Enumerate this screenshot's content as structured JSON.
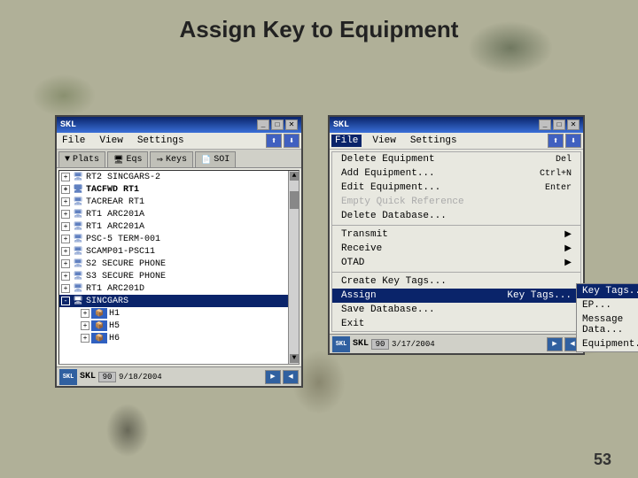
{
  "page": {
    "title": "Assign Key to Equipment",
    "page_number": "53"
  },
  "left_window": {
    "title": "SKL",
    "menu": [
      "File",
      "View",
      "Settings"
    ],
    "tabs": [
      {
        "label": "Plats",
        "icon": "▼",
        "active": false
      },
      {
        "label": "Eqs",
        "icon": "🖥",
        "active": false
      },
      {
        "label": "Keys",
        "icon": "🔑",
        "active": false
      },
      {
        "label": "SOI",
        "icon": "📄",
        "active": false
      }
    ],
    "tree_items": [
      {
        "label": "RT2 SINCGARS-2",
        "indent": 0,
        "expand": "+",
        "icon": "🖥",
        "selected": false
      },
      {
        "label": "TACFWD RT1",
        "indent": 0,
        "expand": "+",
        "icon": "🖥",
        "selected": false,
        "bold": true
      },
      {
        "label": "TACREAR RT1",
        "indent": 0,
        "expand": "+",
        "icon": "🖥",
        "selected": false
      },
      {
        "label": "RT1 ARC201A",
        "indent": 0,
        "expand": "+",
        "icon": "🖥",
        "selected": false
      },
      {
        "label": "RT1 ARC201A",
        "indent": 0,
        "expand": "+",
        "icon": "🖥",
        "selected": false
      },
      {
        "label": "PSC-5 TERM-001",
        "indent": 0,
        "expand": "+",
        "icon": "🖥",
        "selected": false
      },
      {
        "label": "SCAMP01-PSC11",
        "indent": 0,
        "expand": "+",
        "icon": "🖥",
        "selected": false
      },
      {
        "label": "S2 SECURE PHONE",
        "indent": 0,
        "expand": "+",
        "icon": "🖥",
        "selected": false
      },
      {
        "label": "S3 SECURE PHONE",
        "indent": 0,
        "expand": "+",
        "icon": "🖥",
        "selected": false
      },
      {
        "label": "RT1 ARC201D",
        "indent": 0,
        "expand": "+",
        "icon": "🖥",
        "selected": false
      },
      {
        "label": "SINCGARS",
        "indent": 0,
        "expand": "-",
        "icon": "🖥",
        "selected": true
      },
      {
        "label": "H1",
        "indent": 1,
        "expand": "+",
        "icon": "📦",
        "selected": false
      },
      {
        "label": "H5",
        "indent": 1,
        "expand": "+",
        "icon": "📦",
        "selected": false
      },
      {
        "label": "H6",
        "indent": 1,
        "expand": "+",
        "icon": "📦",
        "selected": false
      }
    ],
    "status_bar": {
      "icon_label": "SKL",
      "num": "90",
      "date": "9/18/2004"
    }
  },
  "right_window": {
    "title": "SKL",
    "menu": [
      "File",
      "View",
      "Settings"
    ],
    "active_menu": "File",
    "menu_items": [
      {
        "label": "Delete Equipment",
        "shortcut": "Del",
        "disabled": false
      },
      {
        "label": "Add Equipment...",
        "shortcut": "Ctrl+N",
        "disabled": false
      },
      {
        "label": "Edit Equipment...",
        "shortcut": "Enter",
        "disabled": false
      },
      {
        "label": "Empty Quick Reference",
        "shortcut": "",
        "disabled": true
      },
      {
        "label": "Delete Database...",
        "shortcut": "",
        "disabled": false
      }
    ],
    "separator1": true,
    "menu_items2": [
      {
        "label": "Transmit",
        "shortcut": "",
        "arrow": "▶",
        "disabled": false
      },
      {
        "label": "Receive",
        "shortcut": "",
        "arrow": "▶",
        "disabled": false
      },
      {
        "label": "OTAD",
        "shortcut": "",
        "arrow": "▶",
        "disabled": false
      }
    ],
    "separator2": true,
    "menu_items3": [
      {
        "label": "Create Key Tags...",
        "shortcut": "",
        "disabled": false
      }
    ],
    "assign_item": {
      "label": "Assign",
      "submenu_label": "Key Tags...",
      "highlighted": true,
      "subitems": [
        "EP...",
        "Message Data...",
        "Equipment..."
      ]
    },
    "menu_items4": [
      {
        "label": "Save Database...",
        "shortcut": "",
        "disabled": false
      },
      {
        "label": "Exit",
        "shortcut": "",
        "disabled": false
      }
    ],
    "status_bar": {
      "icon_label": "SKL",
      "num": "90",
      "date": "3/17/2004"
    }
  }
}
